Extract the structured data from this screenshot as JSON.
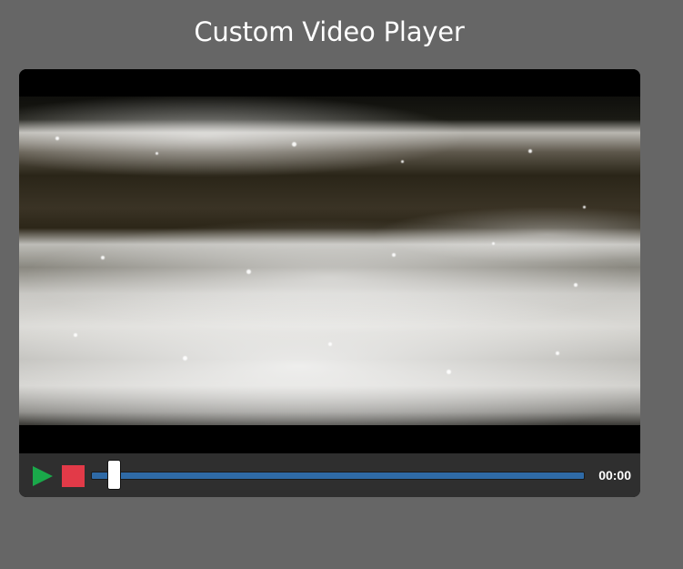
{
  "page": {
    "title": "Custom Video Player"
  },
  "player": {
    "time_display": "00:00",
    "progress_fraction": 0.03,
    "colors": {
      "play": "#1aa84a",
      "stop": "#e23a48",
      "progress": "#2f6aa6",
      "controls_bg": "#2f2f2f",
      "page_bg": "#666666"
    },
    "icons": {
      "play": "play-icon",
      "stop": "stop-icon"
    }
  }
}
